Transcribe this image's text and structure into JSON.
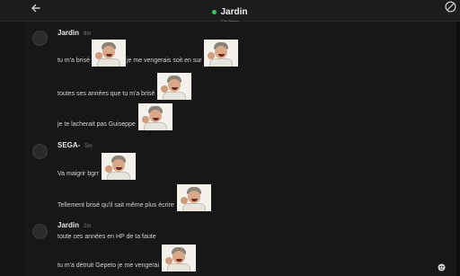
{
  "header": {
    "title": "Jardin",
    "status": "En ligne"
  },
  "messages": [
    {
      "author": "Jardin",
      "time": "9m",
      "lines": [
        {
          "before": "tu m'a brisé",
          "after": "je me vengerais soit en sur"
        },
        {
          "before": "toutes ses années que tu m'a brisé",
          "after": ""
        },
        {
          "before": "je te lacherait pas Guiseppe",
          "after": ""
        }
      ]
    },
    {
      "author": "SEGA-",
      "time": "5m",
      "lines": [
        {
          "before": "Va maigrir bgrr",
          "after": ""
        },
        {
          "before": "Tellement brisé qu'il sait même plus écrire",
          "after": ""
        }
      ]
    },
    {
      "author": "Jardin",
      "time": "2m",
      "lines": [
        {
          "before": "toute ces années en HP de ta faute",
          "after": ""
        },
        {
          "before": "tu m'a détruit Gepeto je me vengerai",
          "after": ""
        }
      ]
    }
  ],
  "colors": {
    "online": "#3ec26a",
    "background": "#171717"
  }
}
